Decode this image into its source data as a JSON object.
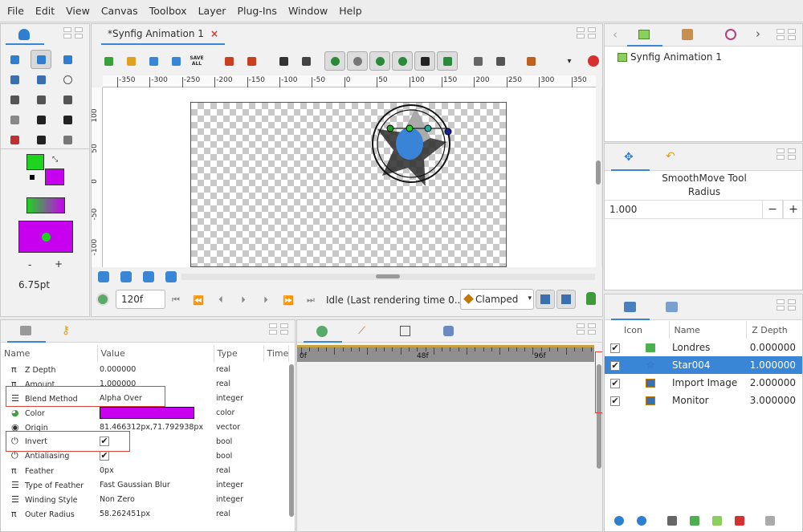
{
  "menu": [
    "File",
    "Edit",
    "View",
    "Canvas",
    "Toolbox",
    "Layer",
    "Plug-Ins",
    "Window",
    "Help"
  ],
  "doc_tab": {
    "title": "*Synfig Animation 1",
    "close": "×"
  },
  "canvas_toolbar": {
    "save_all_label": "SAVE ALL"
  },
  "ruler_h": [
    "-350",
    "-300",
    "-250",
    "-200",
    "-150",
    "-100",
    "-50",
    "0",
    "50",
    "100",
    "150",
    "200",
    "250",
    "300",
    "350"
  ],
  "ruler_v": [
    "100",
    "50",
    "0",
    "-50",
    "-100"
  ],
  "toolbox": {
    "brush_size": "6.75pt",
    "minus": "-",
    "plus": "+",
    "outline_color": "#1fd31f",
    "fill_color": "#c800f0"
  },
  "timebar": {
    "frame": "120f",
    "status": "Idle (Last rendering time 0....",
    "interpolation": "Clamped"
  },
  "canvas_browser": {
    "item": "Synfig Animation 1"
  },
  "tool_options": {
    "title": "SmoothMove Tool",
    "label": "Radius",
    "value": "1.000",
    "minus": "−",
    "plus": "+"
  },
  "params": {
    "headers": [
      "Name",
      "Value",
      "Type",
      "Time"
    ],
    "rows": [
      {
        "name": "Z Depth",
        "value": "0.000000",
        "type": "real",
        "icon": "pi-icon"
      },
      {
        "name": "Amount",
        "value": "1.000000",
        "type": "real",
        "icon": "pi-icon"
      },
      {
        "name": "Blend Method",
        "value": "Alpha Over",
        "type": "integer",
        "icon": "blend-icon"
      },
      {
        "name": "Color",
        "value": "",
        "type": "color",
        "icon": "color-icon"
      },
      {
        "name": "Origin",
        "value": "81.466312px,71.792938px",
        "type": "vector",
        "icon": "origin-icon"
      },
      {
        "name": "Invert",
        "value": "",
        "type": "bool",
        "icon": "bool-icon"
      },
      {
        "name": "Antialiasing",
        "value": "",
        "type": "bool",
        "icon": "bool-icon"
      },
      {
        "name": "Feather",
        "value": "0px",
        "type": "real",
        "icon": "pi-icon"
      },
      {
        "name": "Type of Feather",
        "value": "Fast Gaussian Blur",
        "type": "integer",
        "icon": "blend-icon"
      },
      {
        "name": "Winding Style",
        "value": "Non Zero",
        "type": "integer",
        "icon": "blend-icon"
      },
      {
        "name": "Outer Radius",
        "value": "58.262451px",
        "type": "real",
        "icon": "pi-icon"
      }
    ],
    "color_swatch": "#c800f0"
  },
  "timetrack": {
    "labels": [
      "0f",
      "48f",
      "96f"
    ]
  },
  "layers": {
    "headers": [
      "Icon",
      "Name",
      "Z Depth"
    ],
    "rows": [
      {
        "name": "Londres",
        "z": "0.000000",
        "icon": "folder-icon"
      },
      {
        "name": "Star004",
        "z": "1.000000",
        "icon": "star-icon",
        "selected": true
      },
      {
        "name": "Import Image",
        "z": "2.000000",
        "icon": "image-icon"
      },
      {
        "name": "Monitor",
        "z": "3.000000",
        "icon": "image-icon"
      }
    ]
  }
}
